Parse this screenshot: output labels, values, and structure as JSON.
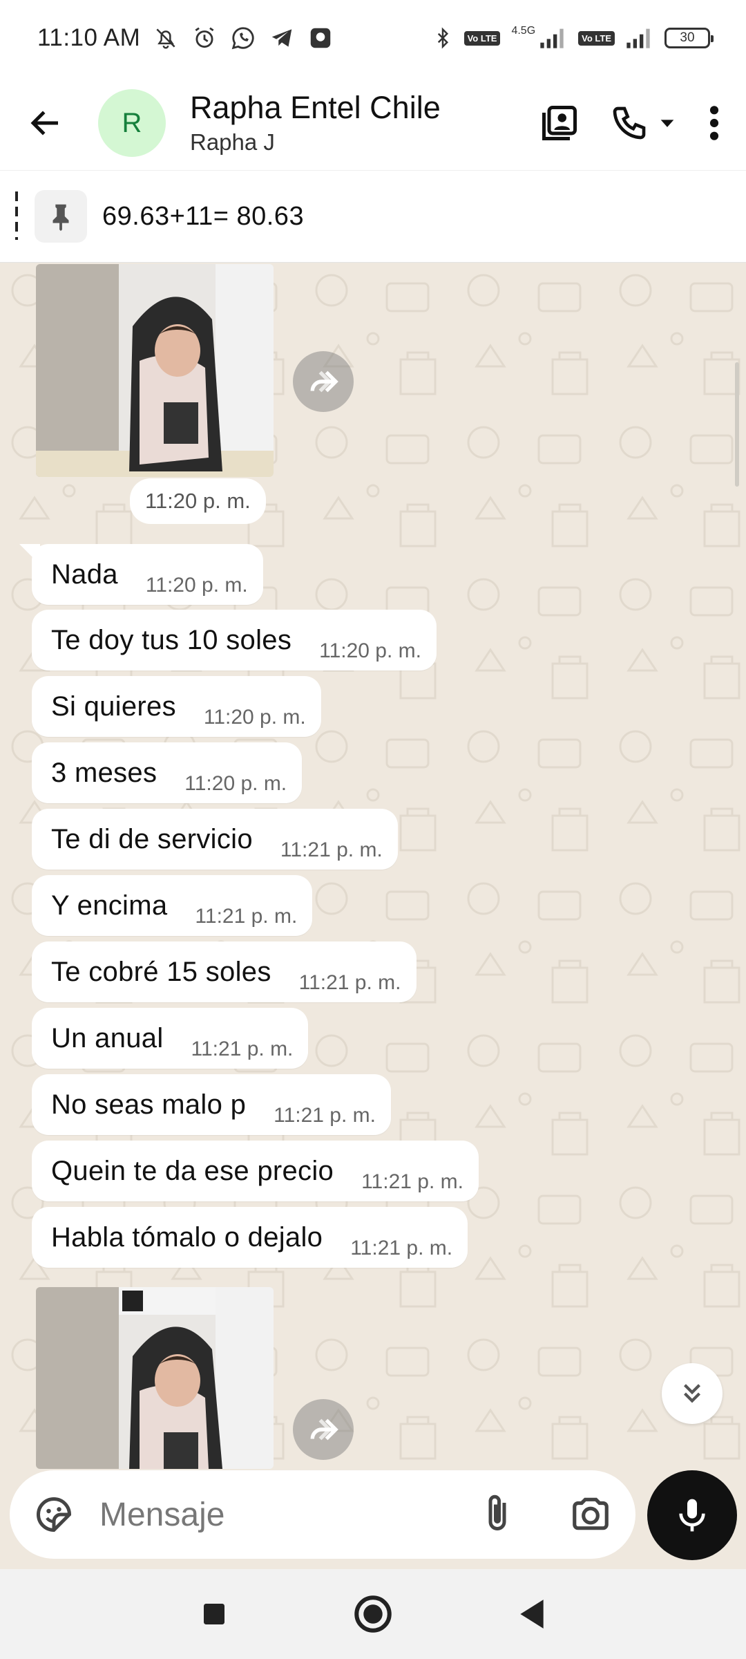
{
  "status_bar": {
    "time": "11:10 AM",
    "network_label": "4.5G",
    "volte_label": "Vo LTE",
    "battery": "30"
  },
  "header": {
    "avatar_initial": "R",
    "contact_name": "Rapha Entel Chile",
    "contact_subtitle": "Rapha J"
  },
  "pinned": {
    "text": "69.63+11= 80.63"
  },
  "chat": {
    "image_time": "11:20 p. m.",
    "messages": [
      {
        "text": "Nada",
        "time": "11:20 p. m."
      },
      {
        "text": "Te doy tus 10 soles",
        "time": "11:20 p. m."
      },
      {
        "text": "Si quieres",
        "time": "11:20 p. m."
      },
      {
        "text": "3 meses",
        "time": "11:20 p. m."
      },
      {
        "text": "Te di de servicio",
        "time": "11:21 p. m."
      },
      {
        "text": "Y encima",
        "time": "11:21 p. m."
      },
      {
        "text": "Te cobré 15 soles",
        "time": "11:21 p. m."
      },
      {
        "text": "Un anual",
        "time": "11:21 p. m."
      },
      {
        "text": "No seas malo p",
        "time": "11:21 p. m."
      },
      {
        "text": "Quein te da ese precio",
        "time": "11:21 p. m."
      },
      {
        "text": "Habla tómalo o dejalo",
        "time": "11:21 p. m."
      }
    ]
  },
  "input": {
    "placeholder": "Mensaje"
  },
  "colors": {
    "chat_background": "#efe8de",
    "avatar_bg": "#d4f7d3",
    "avatar_fg": "#16803c",
    "mic_button": "#111111"
  },
  "icons": {
    "back": "arrow-left-icon",
    "contact_card": "contact-card-icon",
    "call": "phone-icon",
    "call_dropdown": "caret-down-icon",
    "menu": "more-vertical-icon",
    "pin": "pin-icon",
    "forward": "forward-icon",
    "scroll_down": "double-chevron-down-icon",
    "emoji": "sticker-icon",
    "attach": "paperclip-icon",
    "camera": "camera-icon",
    "mic": "mic-icon"
  }
}
